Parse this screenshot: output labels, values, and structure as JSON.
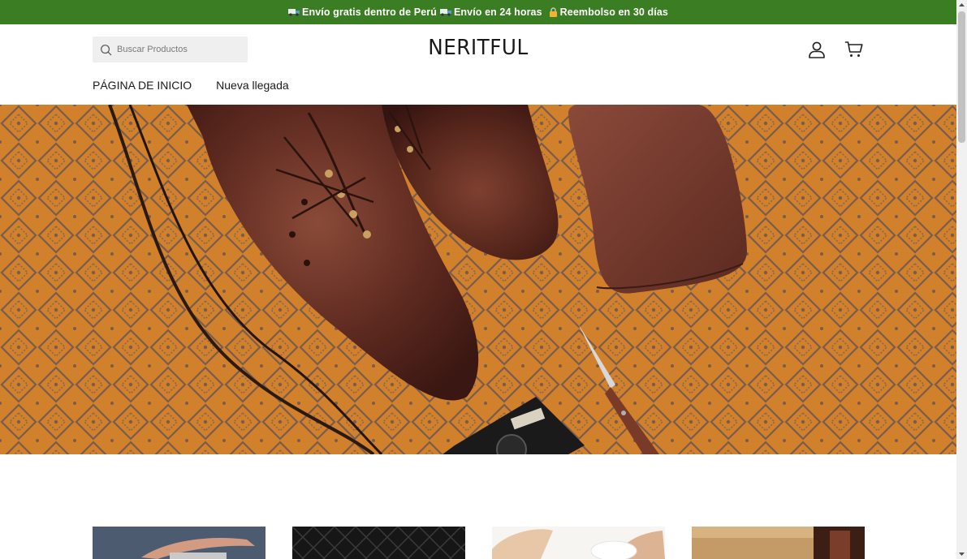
{
  "announcement": {
    "seg1": "Envío gratis dentro de Perú",
    "seg2": "Envío en 24 horas",
    "seg3": "Reembolso en 30 días"
  },
  "header": {
    "search_placeholder": "Buscar Productos",
    "logo": "NERITFUL"
  },
  "nav": {
    "home": "PÁGINA DE INICIO",
    "new_arrivals": "Nueva llegada"
  },
  "icons": {
    "search": "search-icon",
    "account": "user-icon",
    "cart": "cart-icon",
    "announcement_1": "truck-icon",
    "announcement_2": "truck-icon",
    "announcement_3": "lock-icon"
  },
  "colors": {
    "announcement_bg": "#3b7d23",
    "announcement_text": "#ffffff",
    "search_bg": "#efefef",
    "hero_rug": "#d27f2c"
  }
}
